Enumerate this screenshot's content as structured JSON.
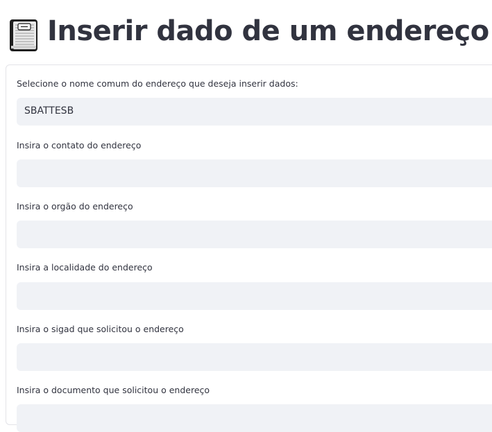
{
  "page": {
    "title": "Inserir dado de um endereço",
    "icon": "book-icon"
  },
  "form": {
    "fields": [
      {
        "label": "Selecione o nome comum do endereço que deseja inserir dados:",
        "value": "SBATTESB",
        "type": "select"
      },
      {
        "label": "Insira o contato do endereço",
        "value": "",
        "type": "text"
      },
      {
        "label": "Insira o orgão do endereço",
        "value": "",
        "type": "text"
      },
      {
        "label": "Insira a localidade do endereço",
        "value": "",
        "type": "text"
      },
      {
        "label": "Insira o sigad que solicitou o endereço",
        "value": "",
        "type": "text"
      },
      {
        "label": "Insira o documento que solicitou o endereço",
        "value": "",
        "type": "text"
      }
    ]
  },
  "colors": {
    "text": "#31333f",
    "input_background": "#f0f2f6",
    "border": "#e3e3e8"
  }
}
